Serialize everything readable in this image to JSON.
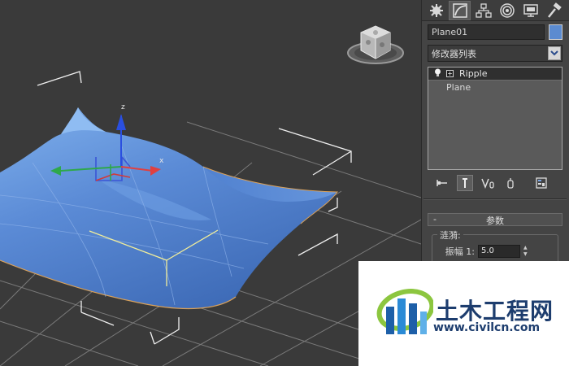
{
  "panel": {
    "tabs": [
      {
        "name": "create-tab",
        "icon": "star-burst-icon",
        "active": false
      },
      {
        "name": "modify-tab",
        "icon": "bend-curve-icon",
        "active": true
      },
      {
        "name": "hierarchy-tab",
        "icon": "hierarchy-tree-icon",
        "active": false
      },
      {
        "name": "motion-tab",
        "icon": "motion-circle-icon",
        "active": false
      },
      {
        "name": "display-tab",
        "icon": "monitor-icon",
        "active": false
      },
      {
        "name": "utilities-tab",
        "icon": "hammer-icon",
        "active": false
      }
    ],
    "object_name": "Plane01",
    "object_color": "#5b8bd0",
    "modifier_list_label": "修改器列表",
    "stack": [
      {
        "label": "Ripple",
        "selected": true,
        "expandable": true
      },
      {
        "label": "Plane",
        "selected": false,
        "expandable": false
      }
    ],
    "rollout_title": "参数",
    "rollout_toggle": "-",
    "group_label": "涟漪:",
    "amplitude_label": "振幅 1:",
    "amplitude_value": "5.0"
  },
  "viewport": {
    "surface_color": "#5b8bd6",
    "axis_labels": {
      "z": "z",
      "x": "x"
    }
  },
  "watermark": {
    "cn": "土木工程网",
    "url": "www.civilcn.com"
  }
}
